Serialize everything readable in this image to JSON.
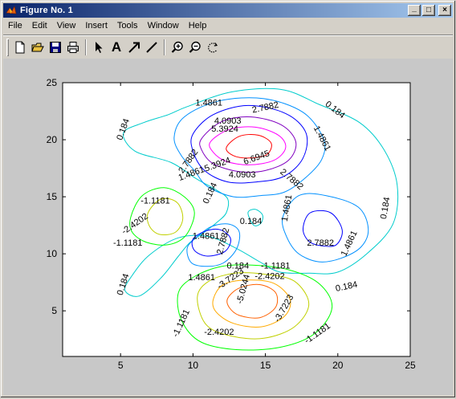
{
  "window": {
    "title": "Figure No. 1"
  },
  "titlebar_buttons": {
    "minimize": "_",
    "maximize": "□",
    "close": "×"
  },
  "menubar": {
    "items": [
      "File",
      "Edit",
      "View",
      "Insert",
      "Tools",
      "Window",
      "Help"
    ]
  },
  "toolbar": {
    "tools": [
      "new-figure",
      "open-file",
      "save",
      "print",
      "select-arrow",
      "insert-text",
      "insert-arrow",
      "insert-line",
      "zoom-in",
      "zoom-out",
      "rotate-3d"
    ],
    "text_tool_label": "A"
  },
  "chart_data": {
    "type": "contour",
    "title": "",
    "xlabel": "",
    "ylabel": "",
    "xlim": [
      1,
      25
    ],
    "ylim": [
      1,
      25
    ],
    "xticks": [
      "5",
      "10",
      "15",
      "20",
      "25"
    ],
    "yticks": [
      "5",
      "10",
      "15",
      "20",
      "25"
    ],
    "levels": [
      "6.6945",
      "5.3924",
      "4.0903",
      "2.7882",
      "1.4861",
      "0.184",
      "-1.1181",
      "-2.4202",
      "-3.7223",
      "-5.0244"
    ],
    "level_colors": {
      "6.6945": "#ff0000",
      "5.3924": "#ff00ff",
      "4.0903": "#8000c0",
      "2.7882": "#0000ff",
      "1.4861": "#0090ff",
      "0.184": "#00cccc",
      "-1.1181": "#00ff00",
      "-2.4202": "#c0d000",
      "-3.7223": "#ffaa00",
      "-5.0244": "#ff6000"
    },
    "labels": [
      {
        "text": "1.4861",
        "x": 11.1,
        "y": 23.2,
        "rot": 0
      },
      {
        "text": "2.7882",
        "x": 15.0,
        "y": 22.8,
        "rot": -12
      },
      {
        "text": "0.184",
        "x": 19.8,
        "y": 22.6,
        "rot": 38
      },
      {
        "text": "4.0903",
        "x": 12.4,
        "y": 21.6,
        "rot": 0
      },
      {
        "text": "5.3924",
        "x": 12.2,
        "y": 20.9,
        "rot": 0
      },
      {
        "text": "0.184",
        "x": 5.2,
        "y": 20.9,
        "rot": -70
      },
      {
        "text": "1.4861",
        "x": 18.9,
        "y": 20.1,
        "rot": 62
      },
      {
        "text": "6.6945",
        "x": 14.4,
        "y": 18.4,
        "rot": -20
      },
      {
        "text": "5.3924",
        "x": 11.7,
        "y": 17.8,
        "rot": -20
      },
      {
        "text": "2.7882",
        "x": 9.7,
        "y": 18.1,
        "rot": -55
      },
      {
        "text": "4.0903",
        "x": 13.4,
        "y": 16.9,
        "rot": 0
      },
      {
        "text": "2.7882",
        "x": 16.8,
        "y": 16.5,
        "rot": 40
      },
      {
        "text": "1.4861",
        "x": 9.9,
        "y": 17.0,
        "rot": -20
      },
      {
        "text": "0.184",
        "x": 11.2,
        "y": 15.3,
        "rot": -65
      },
      {
        "text": "-1.1181",
        "x": 7.4,
        "y": 14.6,
        "rot": 0
      },
      {
        "text": "0.184",
        "x": 23.3,
        "y": 14.0,
        "rot": -80
      },
      {
        "text": "1.4861",
        "x": 16.5,
        "y": 14.0,
        "rot": -80
      },
      {
        "text": "0.184",
        "x": 14.0,
        "y": 12.8,
        "rot": 0
      },
      {
        "text": "-2.4202",
        "x": 6.0,
        "y": 12.6,
        "rot": -35
      },
      {
        "text": "-1.1181",
        "x": 5.5,
        "y": 10.9,
        "rot": 0
      },
      {
        "text": "1.4861",
        "x": 10.9,
        "y": 11.5,
        "rot": 0
      },
      {
        "text": "2.7882",
        "x": 12.1,
        "y": 11.1,
        "rot": -75
      },
      {
        "text": "2.7882",
        "x": 18.8,
        "y": 10.9,
        "rot": 0
      },
      {
        "text": "1.4861",
        "x": 20.8,
        "y": 10.9,
        "rot": -65
      },
      {
        "text": "0.184",
        "x": 13.1,
        "y": 8.9,
        "rot": 0
      },
      {
        "text": "-1.1181",
        "x": 15.7,
        "y": 8.9,
        "rot": 0
      },
      {
        "text": "1.4861",
        "x": 10.6,
        "y": 7.9,
        "rot": 0
      },
      {
        "text": "-3.7223",
        "x": 12.6,
        "y": 7.8,
        "rot": -35
      },
      {
        "text": "-2.4202",
        "x": 15.3,
        "y": 8.0,
        "rot": 0
      },
      {
        "text": "0.184",
        "x": 5.2,
        "y": 7.3,
        "rot": -72
      },
      {
        "text": "0.184",
        "x": 20.6,
        "y": 7.1,
        "rot": -12
      },
      {
        "text": "-5.0244",
        "x": 13.5,
        "y": 6.9,
        "rot": -75
      },
      {
        "text": "-3.7223",
        "x": 16.3,
        "y": 5.2,
        "rot": -60
      },
      {
        "text": "-1.1181",
        "x": 9.2,
        "y": 3.9,
        "rot": -65
      },
      {
        "text": "-2.4202",
        "x": 11.8,
        "y": 3.1,
        "rot": 0
      },
      {
        "text": "-1.1181",
        "x": 18.6,
        "y": 3.0,
        "rot": -35
      }
    ],
    "contours": [
      {
        "level": "0.184",
        "closed": true,
        "pts": [
          [
            9.6,
            22.9
          ],
          [
            12.7,
            24.2
          ],
          [
            16.1,
            24.4
          ],
          [
            18.7,
            23.1
          ],
          [
            21.5,
            21.5
          ],
          [
            23.2,
            19.1
          ],
          [
            24.1,
            16.0
          ],
          [
            23.8,
            12.6
          ],
          [
            22.0,
            10.0
          ],
          [
            20.0,
            8.4
          ],
          [
            18.0,
            8.3
          ],
          [
            16.0,
            8.4
          ],
          [
            14.6,
            9.3
          ],
          [
            13.1,
            10.4
          ],
          [
            11.1,
            11.5
          ],
          [
            9.0,
            11.4
          ],
          [
            7.0,
            9.9
          ],
          [
            5.8,
            8.1
          ],
          [
            5.3,
            6.8
          ],
          [
            6.3,
            6.3
          ],
          [
            7.8,
            7.9
          ],
          [
            9.0,
            9.8
          ],
          [
            9.8,
            11.0
          ],
          [
            10.8,
            11.9
          ],
          [
            11.7,
            12.8
          ],
          [
            12.3,
            13.6
          ],
          [
            12.4,
            14.8
          ],
          [
            11.6,
            15.6
          ],
          [
            10.2,
            16.6
          ],
          [
            8.5,
            18.0
          ],
          [
            6.0,
            19.0
          ],
          [
            5.2,
            20.6
          ],
          [
            6.6,
            21.5
          ],
          [
            8.3,
            22.2
          ],
          [
            9.6,
            22.9
          ]
        ]
      },
      {
        "level": "0.184",
        "closed": true,
        "pts": [
          [
            13.8,
            13.6
          ],
          [
            14.3,
            13.9
          ],
          [
            14.8,
            13.4
          ],
          [
            14.7,
            12.7
          ],
          [
            14.2,
            12.5
          ],
          [
            13.8,
            13.6
          ]
        ]
      },
      {
        "level": "1.4861",
        "closed": true,
        "pts": [
          [
            9.4,
            22.0
          ],
          [
            11.8,
            23.4
          ],
          [
            14.9,
            23.6
          ],
          [
            17.6,
            22.4
          ],
          [
            19.0,
            20.1
          ],
          [
            18.9,
            18.3
          ],
          [
            17.8,
            16.7
          ],
          [
            16.3,
            15.4
          ],
          [
            14.6,
            15.1
          ],
          [
            12.8,
            15.0
          ],
          [
            11.0,
            15.9
          ],
          [
            10.1,
            17.3
          ],
          [
            9.2,
            18.6
          ],
          [
            8.7,
            20.2
          ],
          [
            9.4,
            22.0
          ]
        ]
      },
      {
        "level": "1.4861",
        "closed": true,
        "pts": [
          [
            16.2,
            13.2
          ],
          [
            17.3,
            15.1
          ],
          [
            19.2,
            15.1
          ],
          [
            21.4,
            14.1
          ],
          [
            22.1,
            12.2
          ],
          [
            21.6,
            10.6
          ],
          [
            20.2,
            9.6
          ],
          [
            18.7,
            9.3
          ],
          [
            17.3,
            10.0
          ],
          [
            16.5,
            11.4
          ],
          [
            16.2,
            13.2
          ]
        ]
      },
      {
        "level": "1.4861",
        "closed": true,
        "pts": [
          [
            9.6,
            10.5
          ],
          [
            10.3,
            11.5
          ],
          [
            11.3,
            12.4
          ],
          [
            12.5,
            12.6
          ],
          [
            13.2,
            11.9
          ],
          [
            13.0,
            10.4
          ],
          [
            12.1,
            9.2
          ],
          [
            11.0,
            8.9
          ],
          [
            9.9,
            9.2
          ],
          [
            9.6,
            10.5
          ]
        ]
      },
      {
        "level": "2.7882",
        "closed": true,
        "pts": [
          [
            10.0,
            20.5
          ],
          [
            11.4,
            22.2
          ],
          [
            13.8,
            23.0
          ],
          [
            16.4,
            22.3
          ],
          [
            17.8,
            20.6
          ],
          [
            17.6,
            18.4
          ],
          [
            16.3,
            16.8
          ],
          [
            14.4,
            16.3
          ],
          [
            12.4,
            16.3
          ],
          [
            10.8,
            17.3
          ],
          [
            10.0,
            19.0
          ],
          [
            10.0,
            20.5
          ]
        ]
      },
      {
        "level": "2.7882",
        "closed": true,
        "pts": [
          [
            17.6,
            12.2
          ],
          [
            18.1,
            13.6
          ],
          [
            19.5,
            13.6
          ],
          [
            20.3,
            12.1
          ],
          [
            19.9,
            10.8
          ],
          [
            18.9,
            10.7
          ],
          [
            18.0,
            11.1
          ],
          [
            17.6,
            12.2
          ]
        ]
      },
      {
        "level": "2.7882",
        "closed": true,
        "pts": [
          [
            10.0,
            11.3
          ],
          [
            10.9,
            12.0
          ],
          [
            11.9,
            12.1
          ],
          [
            12.6,
            11.3
          ],
          [
            12.2,
            10.2
          ],
          [
            11.0,
            9.8
          ],
          [
            10.1,
            10.3
          ],
          [
            10.0,
            11.3
          ]
        ]
      },
      {
        "level": "4.0903",
        "closed": true,
        "pts": [
          [
            10.6,
            20.1
          ],
          [
            12.0,
            21.6
          ],
          [
            14.0,
            22.0
          ],
          [
            16.1,
            21.3
          ],
          [
            17.1,
            19.8
          ],
          [
            16.6,
            18.2
          ],
          [
            15.0,
            17.3
          ],
          [
            13.2,
            17.2
          ],
          [
            11.4,
            17.9
          ],
          [
            10.6,
            19.1
          ],
          [
            10.6,
            20.1
          ]
        ]
      },
      {
        "level": "5.3924",
        "closed": true,
        "pts": [
          [
            11.2,
            19.8
          ],
          [
            12.5,
            20.9
          ],
          [
            14.3,
            21.1
          ],
          [
            15.9,
            20.4
          ],
          [
            16.4,
            19.3
          ],
          [
            15.6,
            18.2
          ],
          [
            13.9,
            17.8
          ],
          [
            12.3,
            18.1
          ],
          [
            11.4,
            18.9
          ],
          [
            11.2,
            19.8
          ]
        ]
      },
      {
        "level": "6.6945",
        "closed": true,
        "pts": [
          [
            12.3,
            19.3
          ],
          [
            13.2,
            20.3
          ],
          [
            14.5,
            20.4
          ],
          [
            15.4,
            19.7
          ],
          [
            15.1,
            18.7
          ],
          [
            13.9,
            18.4
          ],
          [
            12.8,
            18.6
          ],
          [
            12.3,
            19.3
          ]
        ]
      },
      {
        "level": "-1.1181",
        "closed": true,
        "pts": [
          [
            5.7,
            13.2
          ],
          [
            6.5,
            15.1
          ],
          [
            8.0,
            15.8
          ],
          [
            9.4,
            15.0
          ],
          [
            10.1,
            13.6
          ],
          [
            9.5,
            11.6
          ],
          [
            8.3,
            10.8
          ],
          [
            6.8,
            11.0
          ],
          [
            5.8,
            11.9
          ],
          [
            5.7,
            13.2
          ]
        ]
      },
      {
        "level": "-1.1181",
        "closed": true,
        "pts": [
          [
            9.0,
            6.6
          ],
          [
            10.1,
            8.0
          ],
          [
            12.0,
            8.9
          ],
          [
            14.1,
            9.0
          ],
          [
            16.6,
            8.6
          ],
          [
            18.7,
            7.4
          ],
          [
            19.6,
            5.3
          ],
          [
            18.4,
            3.0
          ],
          [
            16.0,
            1.8
          ],
          [
            13.0,
            1.6
          ],
          [
            10.5,
            2.3
          ],
          [
            9.2,
            4.2
          ],
          [
            9.0,
            6.6
          ]
        ]
      },
      {
        "level": "-2.4202",
        "closed": true,
        "pts": [
          [
            6.9,
            13.6
          ],
          [
            7.8,
            14.8
          ],
          [
            8.9,
            14.5
          ],
          [
            9.3,
            13.1
          ],
          [
            8.8,
            11.9
          ],
          [
            7.7,
            11.7
          ],
          [
            7.0,
            12.4
          ],
          [
            6.9,
            13.6
          ]
        ]
      },
      {
        "level": "-2.4202",
        "closed": true,
        "pts": [
          [
            10.3,
            6.2
          ],
          [
            11.1,
            7.6
          ],
          [
            12.9,
            8.3
          ],
          [
            15.0,
            8.2
          ],
          [
            17.0,
            7.6
          ],
          [
            18.0,
            5.6
          ],
          [
            17.0,
            3.6
          ],
          [
            14.9,
            2.6
          ],
          [
            12.6,
            2.8
          ],
          [
            10.9,
            3.8
          ],
          [
            10.3,
            6.2
          ]
        ]
      },
      {
        "level": "-3.7223",
        "closed": true,
        "pts": [
          [
            11.4,
            6.0
          ],
          [
            12.1,
            7.3
          ],
          [
            13.8,
            7.7
          ],
          [
            15.6,
            7.4
          ],
          [
            16.7,
            6.0
          ],
          [
            16.3,
            4.5
          ],
          [
            14.7,
            3.6
          ],
          [
            12.8,
            3.9
          ],
          [
            11.6,
            4.9
          ],
          [
            11.4,
            6.0
          ]
        ]
      },
      {
        "level": "-5.0244",
        "closed": true,
        "pts": [
          [
            12.4,
            6.1
          ],
          [
            13.2,
            7.0
          ],
          [
            14.6,
            7.3
          ],
          [
            15.7,
            6.6
          ],
          [
            15.7,
            5.3
          ],
          [
            14.6,
            4.4
          ],
          [
            13.2,
            4.6
          ],
          [
            12.5,
            5.3
          ],
          [
            12.4,
            6.1
          ]
        ]
      }
    ]
  }
}
